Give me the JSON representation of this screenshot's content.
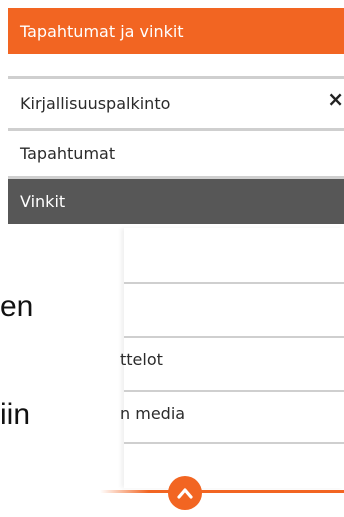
{
  "header": {
    "title": "Tapahtumat ja vinkit"
  },
  "menu": {
    "items": [
      {
        "label": "Kirjallisuuspalkinto",
        "close_glyph": "×"
      },
      {
        "label": "Tapahtumat"
      },
      {
        "label": "Vinkit"
      }
    ]
  },
  "lower_card": {
    "items": [
      {
        "label": "ttelot"
      },
      {
        "label": "n media"
      }
    ]
  },
  "background_text": {
    "line1": "en",
    "line2": "iin"
  },
  "colors": {
    "accent": "#f26522",
    "active_bg": "#575757",
    "divider": "#cfcfcf"
  },
  "icons": {
    "close": "close-icon",
    "scroll_up": "chevron-up-icon"
  }
}
